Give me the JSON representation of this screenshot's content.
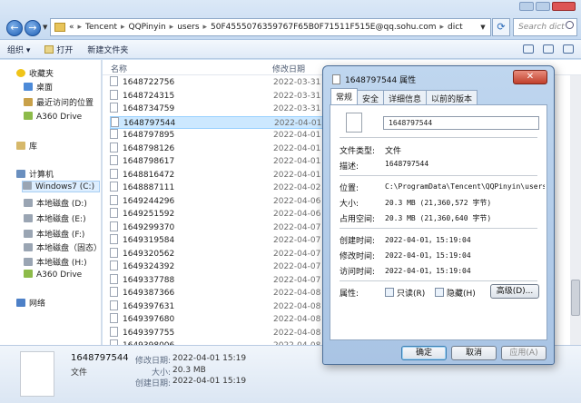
{
  "address": {
    "back": "←",
    "forward": "→",
    "prefix": "«",
    "segments": [
      "Tencent",
      "QQPinyin",
      "users",
      "50F4555076359767F65B0F71511F515E@qq.sohu.com",
      "dict"
    ],
    "search_placeholder": "Search dict"
  },
  "toolbar": {
    "organize": "组织 ▾",
    "open": "打开",
    "new_folder": "新建文件夹"
  },
  "navpane": {
    "favorites": "收藏夹",
    "desktop": "桌面",
    "recent": "最近访问的位置",
    "a360": "A360 Drive",
    "libraries": "库",
    "computer": "计算机",
    "drives": [
      "Windows7 (C:)",
      "本地磁盘 (D:)",
      "本地磁盘 (E:)",
      "本地磁盘 (F:)",
      "本地磁盘（固态）",
      "本地磁盘 (H:)"
    ],
    "a360_2": "A360 Drive",
    "network": "网络"
  },
  "filelist": {
    "col_name": "名称",
    "col_date": "修改日期",
    "rows": [
      {
        "name": "1648722756",
        "date": "2022-03-31 1"
      },
      {
        "name": "1648724315",
        "date": "2022-03-31 1"
      },
      {
        "name": "1648734759",
        "date": "2022-03-31 2"
      },
      {
        "name": "1648797544",
        "date": "2022-04-01 1"
      },
      {
        "name": "1648797895",
        "date": "2022-04-01 1"
      },
      {
        "name": "1648798126",
        "date": "2022-04-01 1"
      },
      {
        "name": "1648798617",
        "date": "2022-04-01 1"
      },
      {
        "name": "1648816472",
        "date": "2022-04-01 2"
      },
      {
        "name": "1648887111",
        "date": "2022-04-02 1"
      },
      {
        "name": "1649244296",
        "date": "2022-04-06 1"
      },
      {
        "name": "1649251592",
        "date": "2022-04-06 2"
      },
      {
        "name": "1649299370",
        "date": "2022-04-07 1"
      },
      {
        "name": "1649319584",
        "date": "2022-04-07 1"
      },
      {
        "name": "1649320562",
        "date": "2022-04-07 1"
      },
      {
        "name": "1649324392",
        "date": "2022-04-07 1"
      },
      {
        "name": "1649337788",
        "date": "2022-04-07 2"
      },
      {
        "name": "1649387366",
        "date": "2022-04-08 1"
      },
      {
        "name": "1649397631",
        "date": "2022-04-08 1"
      },
      {
        "name": "1649397680",
        "date": "2022-04-08 1"
      },
      {
        "name": "1649397755",
        "date": "2022-04-08 1"
      },
      {
        "name": "1649398006",
        "date": "2022-04-08 1"
      }
    ]
  },
  "details": {
    "name": "1648797544",
    "type": "文件",
    "modified_label": "修改日期:",
    "modified": "2022-04-01 15:19",
    "size_label": "大小:",
    "size": "20.3 MB",
    "created_label": "创建日期:",
    "created": "2022-04-01 15:19"
  },
  "dialog": {
    "title": "1648797544 属性",
    "close": "✕",
    "tabs": [
      "常规",
      "安全",
      "详细信息",
      "以前的版本"
    ],
    "filename": "1648797544",
    "type_label": "文件类型:",
    "type_value": "文件",
    "desc_label": "描述:",
    "desc_value": "1648797544",
    "location_label": "位置:",
    "location_value": "C:\\ProgramData\\Tencent\\QQPinyin\\users\\50F",
    "size_label": "大小:",
    "size_value": "20.3 MB (21,360,572 字节)",
    "ondisk_label": "占用空间:",
    "ondisk_value": "20.3 MB (21,360,640 字节)",
    "created_label": "创建时间:",
    "created_value": "2022-04-01，15:19:04",
    "modified_label": "修改时间:",
    "modified_value": "2022-04-01，15:19:04",
    "accessed_label": "访问时间:",
    "accessed_value": "2022-04-01，15:19:04",
    "attrs_label": "属性:",
    "readonly_label": "只读(R)",
    "hidden_label": "隐藏(H)",
    "advanced_label": "高级(D)...",
    "ok_label": "确定",
    "cancel_label": "取消",
    "apply_label": "应用(A)"
  }
}
